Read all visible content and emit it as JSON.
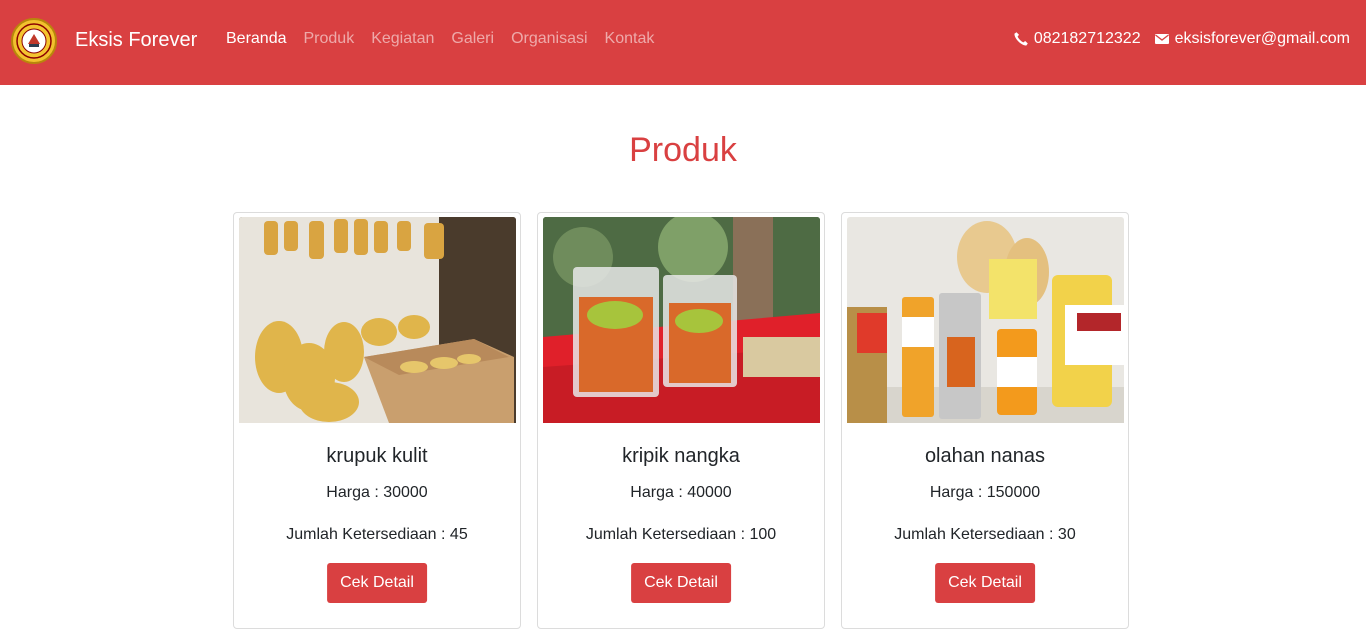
{
  "brand": {
    "name": "Eksis Forever",
    "logo_icon": "school-emblem-icon"
  },
  "nav": {
    "items": [
      {
        "label": "Beranda",
        "active": true
      },
      {
        "label": "Produk",
        "active": false
      },
      {
        "label": "Kegiatan",
        "active": false
      },
      {
        "label": "Galeri",
        "active": false
      },
      {
        "label": "Organisasi",
        "active": false
      },
      {
        "label": "Kontak",
        "active": false
      }
    ]
  },
  "contact": {
    "phone": "082182712322",
    "phone_icon": "phone-icon",
    "email": "eksisforever@gmail.com",
    "email_icon": "envelope-icon"
  },
  "section": {
    "title": "Produk"
  },
  "products": [
    {
      "name": "krupuk kulit",
      "price": "Harga : 30000",
      "stock": "Jumlah Ketersediaan : 45",
      "button": "Cek Detail"
    },
    {
      "name": "kripik nangka",
      "price": "Harga : 40000",
      "stock": "Jumlah Ketersediaan : 100",
      "button": "Cek Detail"
    },
    {
      "name": "olahan nanas",
      "price": "Harga : 150000",
      "stock": "Jumlah Ketersediaan : 30",
      "button": "Cek Detail"
    }
  ],
  "colors": {
    "primary": "#d94041",
    "white": "#ffffff"
  }
}
